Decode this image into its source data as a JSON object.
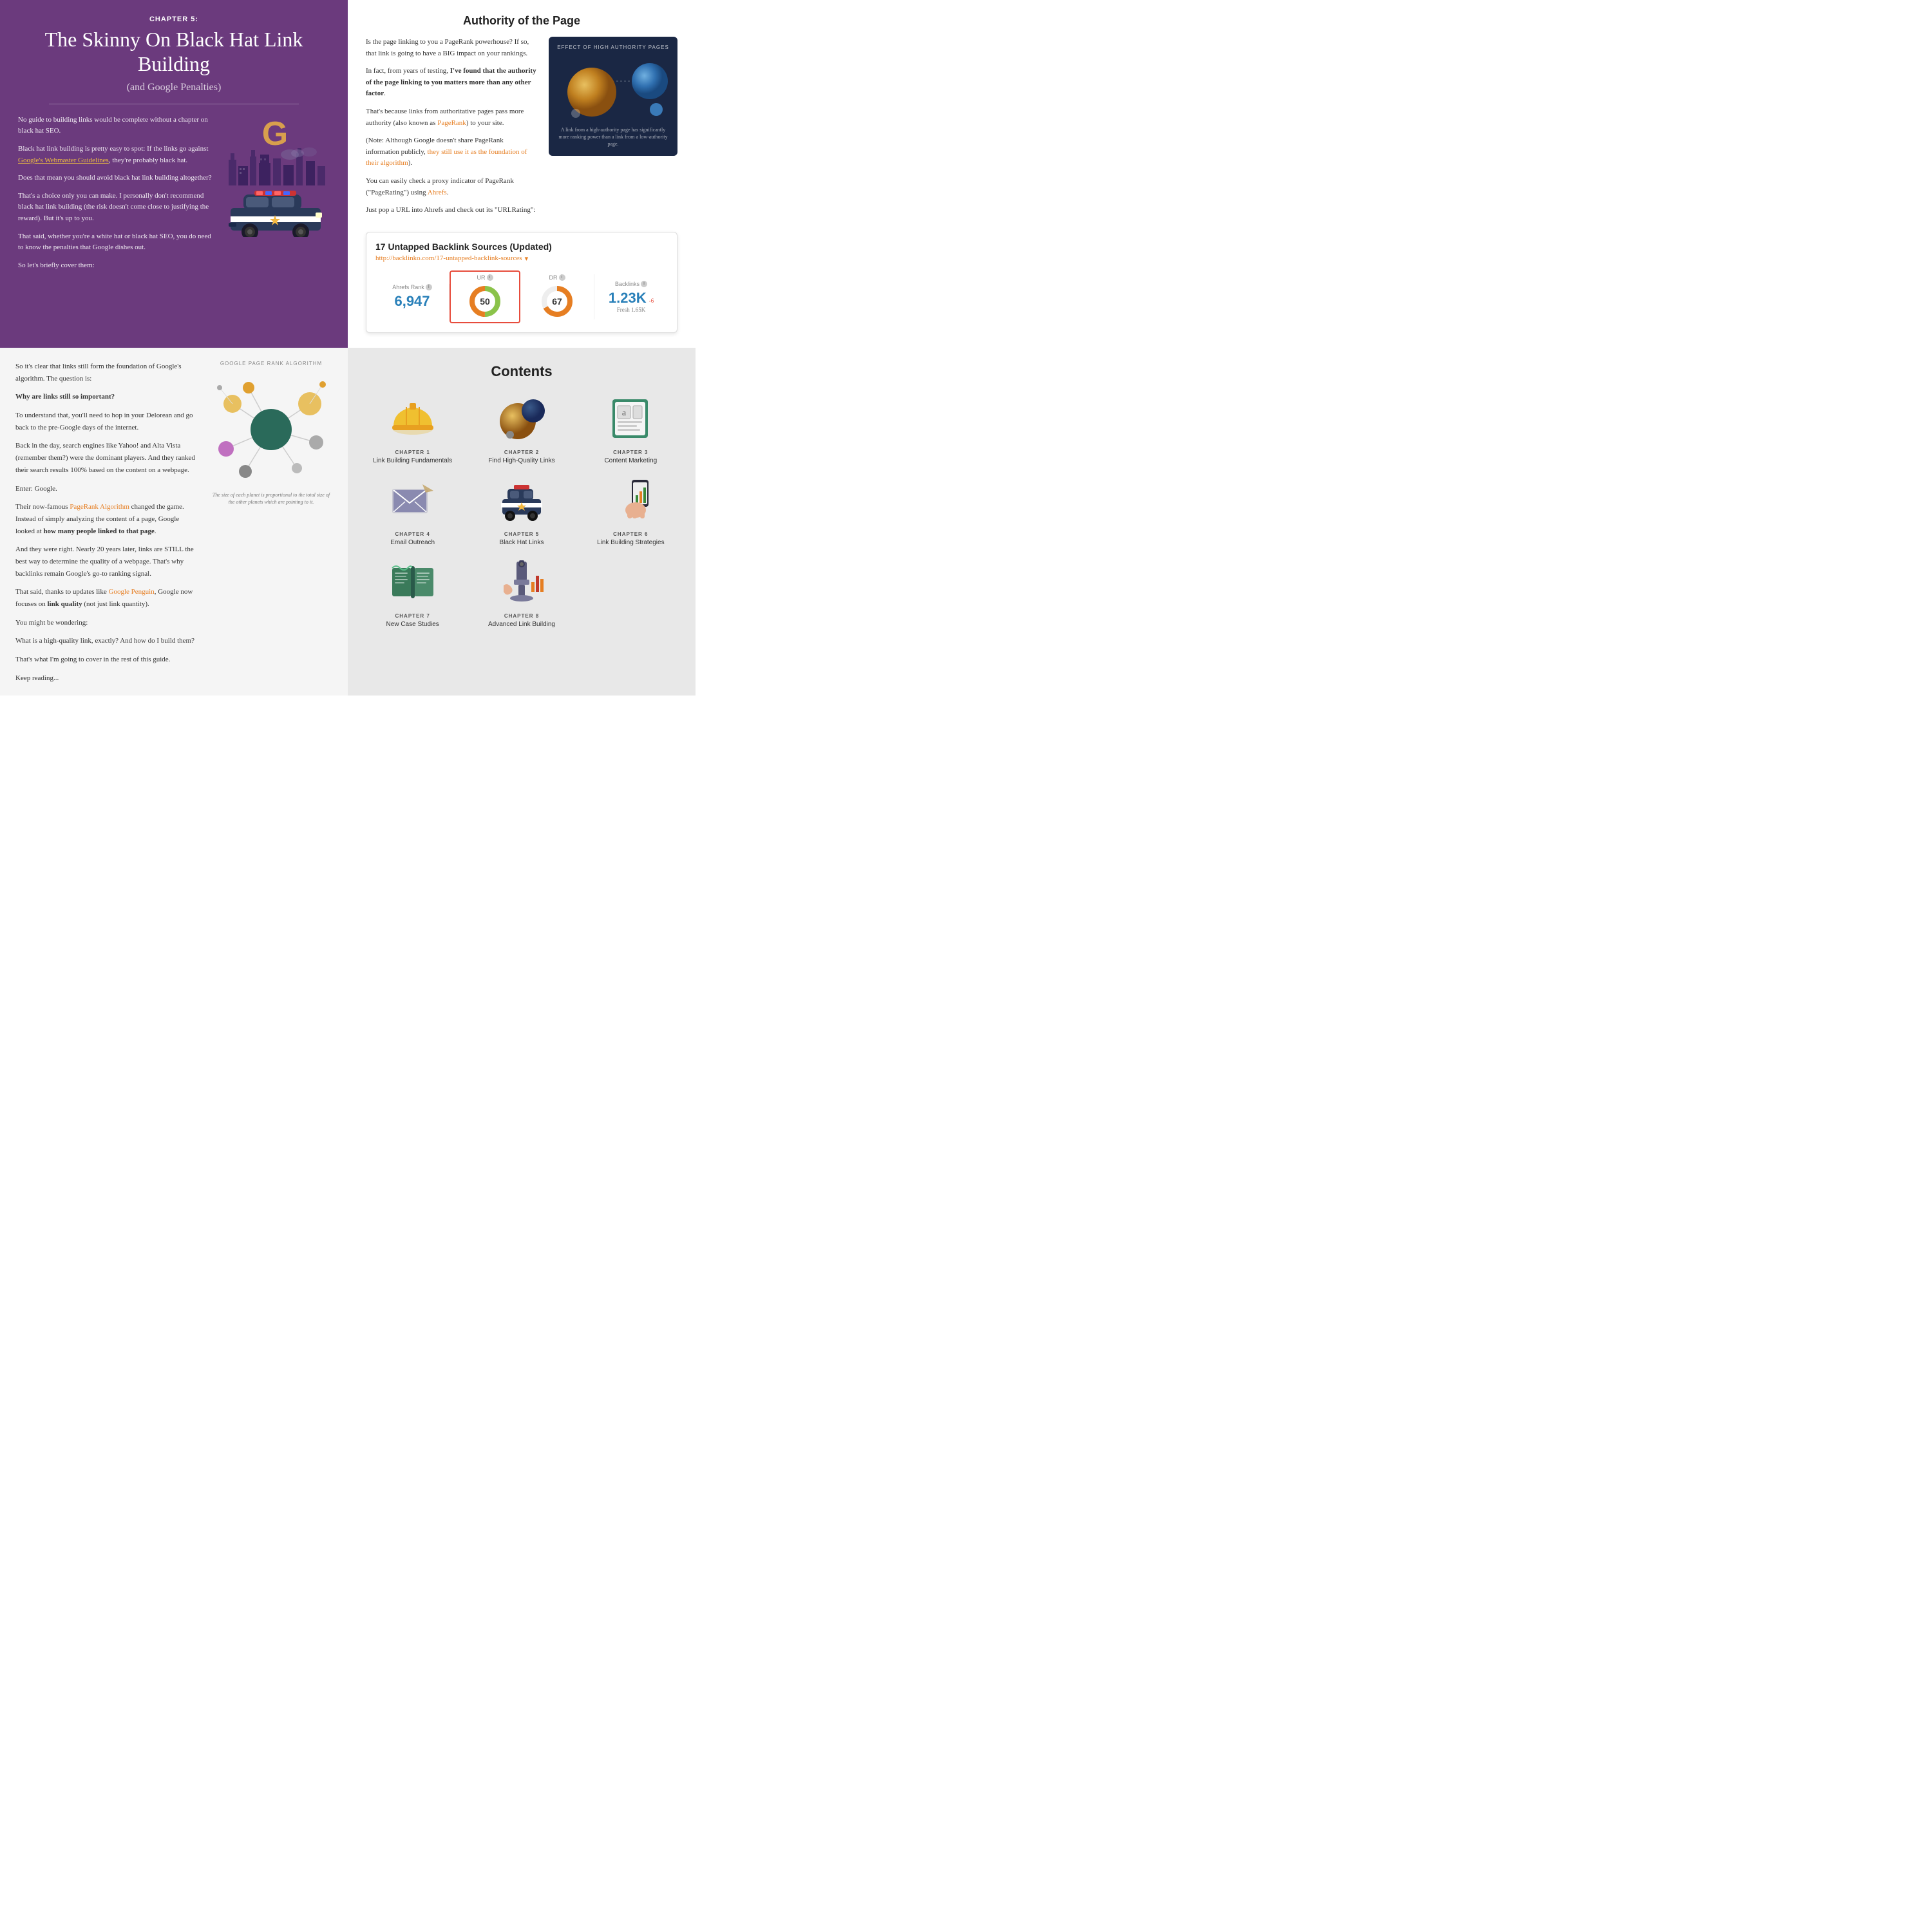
{
  "quad_top_left": {
    "chapter_label": "CHAPTER 5:",
    "chapter_title": "The Skinny On Black Hat Link Building",
    "chapter_subtitle": "(and Google Penalties)",
    "para1": "No guide to building links would be complete without a chapter on black hat SEO.",
    "para2_prefix": "Black hat link building is pretty easy to spot: If the links go against ",
    "para2_link": "Google's Webmaster Guidelines",
    "para2_suffix": ", they're probably black hat.",
    "para3": "Does that mean you should avoid black hat link building altogether?",
    "para4": "That's a choice only you can make. I personally don't recommend black hat link building (the risk doesn't come close to justifying the reward). But it's up to you.",
    "para5": "That said, whether you're a white hat or black hat SEO, you do need to know the penalties that Google dishes out.",
    "para6": "So let's briefly cover them:"
  },
  "quad_top_right": {
    "title": "Authority of the Page",
    "para1": "Is the page linking to you a PageRank powerhouse? If so, that link is going to have a BIG impact on your rankings.",
    "para2_prefix": "In fact, from years of testing, ",
    "para2_bold": "I've found that the authority of the page linking to you matters more than any other factor",
    "para2_suffix": ".",
    "para3_prefix": "That's because links from authoritative pages pass more authority (also known as ",
    "para3_link": "PageRank",
    "para3_suffix": ") to your site.",
    "para4_prefix": "(Note: Although Google doesn't share PageRank information publicly, ",
    "para4_link": "they still use it as the foundation of their algorithm",
    "para4_suffix": ").",
    "para5_prefix": "You can easily check a proxy indicator of PageRank (\"PageRating\") using ",
    "para5_link": "Ahrefs",
    "para5_suffix": ".",
    "para6": "Just pop a URL into Ahrefs and check out its \"URLRating\":",
    "planet_diagram_title": "EFFECT OF HIGH AUTHORITY PAGES",
    "planet_diagram_caption": "A link from a high-authority page has significantly more ranking power than a link from a low-authority page.",
    "widget_title": "17 Untapped Backlink Sources (Updated)",
    "widget_url": "http://backlinko.com/17-untapped-backlink-sources",
    "stats": {
      "ahrefs_rank_label": "Ahrefs Rank",
      "ahrefs_rank_value": "6,947",
      "ur_label": "UR",
      "ur_value": "50",
      "dr_label": "DR",
      "dr_value": "67",
      "backlinks_label": "Backlinks",
      "backlinks_value": "1.23K",
      "backlinks_change": "-6",
      "backlinks_fresh": "Fresh 1.65K"
    }
  },
  "quad_bottom_left": {
    "para1": "So it's clear that links still form the foundation of Google's algorithm. The question is:",
    "why_bold": "Why are links still so important?",
    "para2": "To understand that, you'll need to hop in your Delorean and go back to the pre-Google days of the internet.",
    "para3": "Back in the day, search engines like Yahoo! and Alta Vista (remember them?) were the dominant players. And they ranked their search results 100% based on the content on a webpage.",
    "para4": "Enter: Google.",
    "para5_prefix": "Their now-famous ",
    "para5_link": "PageRank Algorithm",
    "para5_suffix": " changed the game. Instead of simply analyzing the content of a page, Google looked at ",
    "para5_bold": "how many people linked to that page",
    "para5_end": ".",
    "para6": "And they were right. Nearly 20 years later, links are STILL the best way to determine the quality of a webpage. That's why backlinks remain Google's go-to ranking signal.",
    "para7_prefix": "That said, thanks to updates like ",
    "para7_link": "Google Penguin",
    "para7_suffix": ", Google now focuses on ",
    "para7_bold": "link quality",
    "para7_end": " (not just link quantity).",
    "para8": "You might be wondering:",
    "para9": "What is a high-quality link, exactly? And how do I build them?",
    "para10": "That's what I'm going to cover in the rest of this guide.",
    "para11": "Keep reading...",
    "diagram_label": "GOOGLE PAGE RANK ALGORITHM",
    "diagram_caption": "The size of each planet is proportional to the total size of the other planets which are pointing to it."
  },
  "quad_bottom_right": {
    "title": "Contents",
    "chapters": [
      {
        "number": "CHAPTER 1",
        "name": "Link Building Fundamentals",
        "icon": "hardhat"
      },
      {
        "number": "CHAPTER 2",
        "name": "Find High-Quality Links",
        "icon": "planet"
      },
      {
        "number": "CHAPTER 3",
        "name": "Content Marketing",
        "icon": "computer"
      },
      {
        "number": "CHAPTER 4",
        "name": "Email Outreach",
        "icon": "envelope"
      },
      {
        "number": "CHAPTER 5",
        "name": "Black Hat Links",
        "icon": "police-car"
      },
      {
        "number": "CHAPTER 6",
        "name": "Link Building Strategies",
        "icon": "strategies"
      },
      {
        "number": "CHAPTER 7",
        "name": "New Case Studies",
        "icon": "book"
      },
      {
        "number": "CHAPTER 8",
        "name": "Advanced Link Building",
        "icon": "microscope"
      }
    ]
  }
}
